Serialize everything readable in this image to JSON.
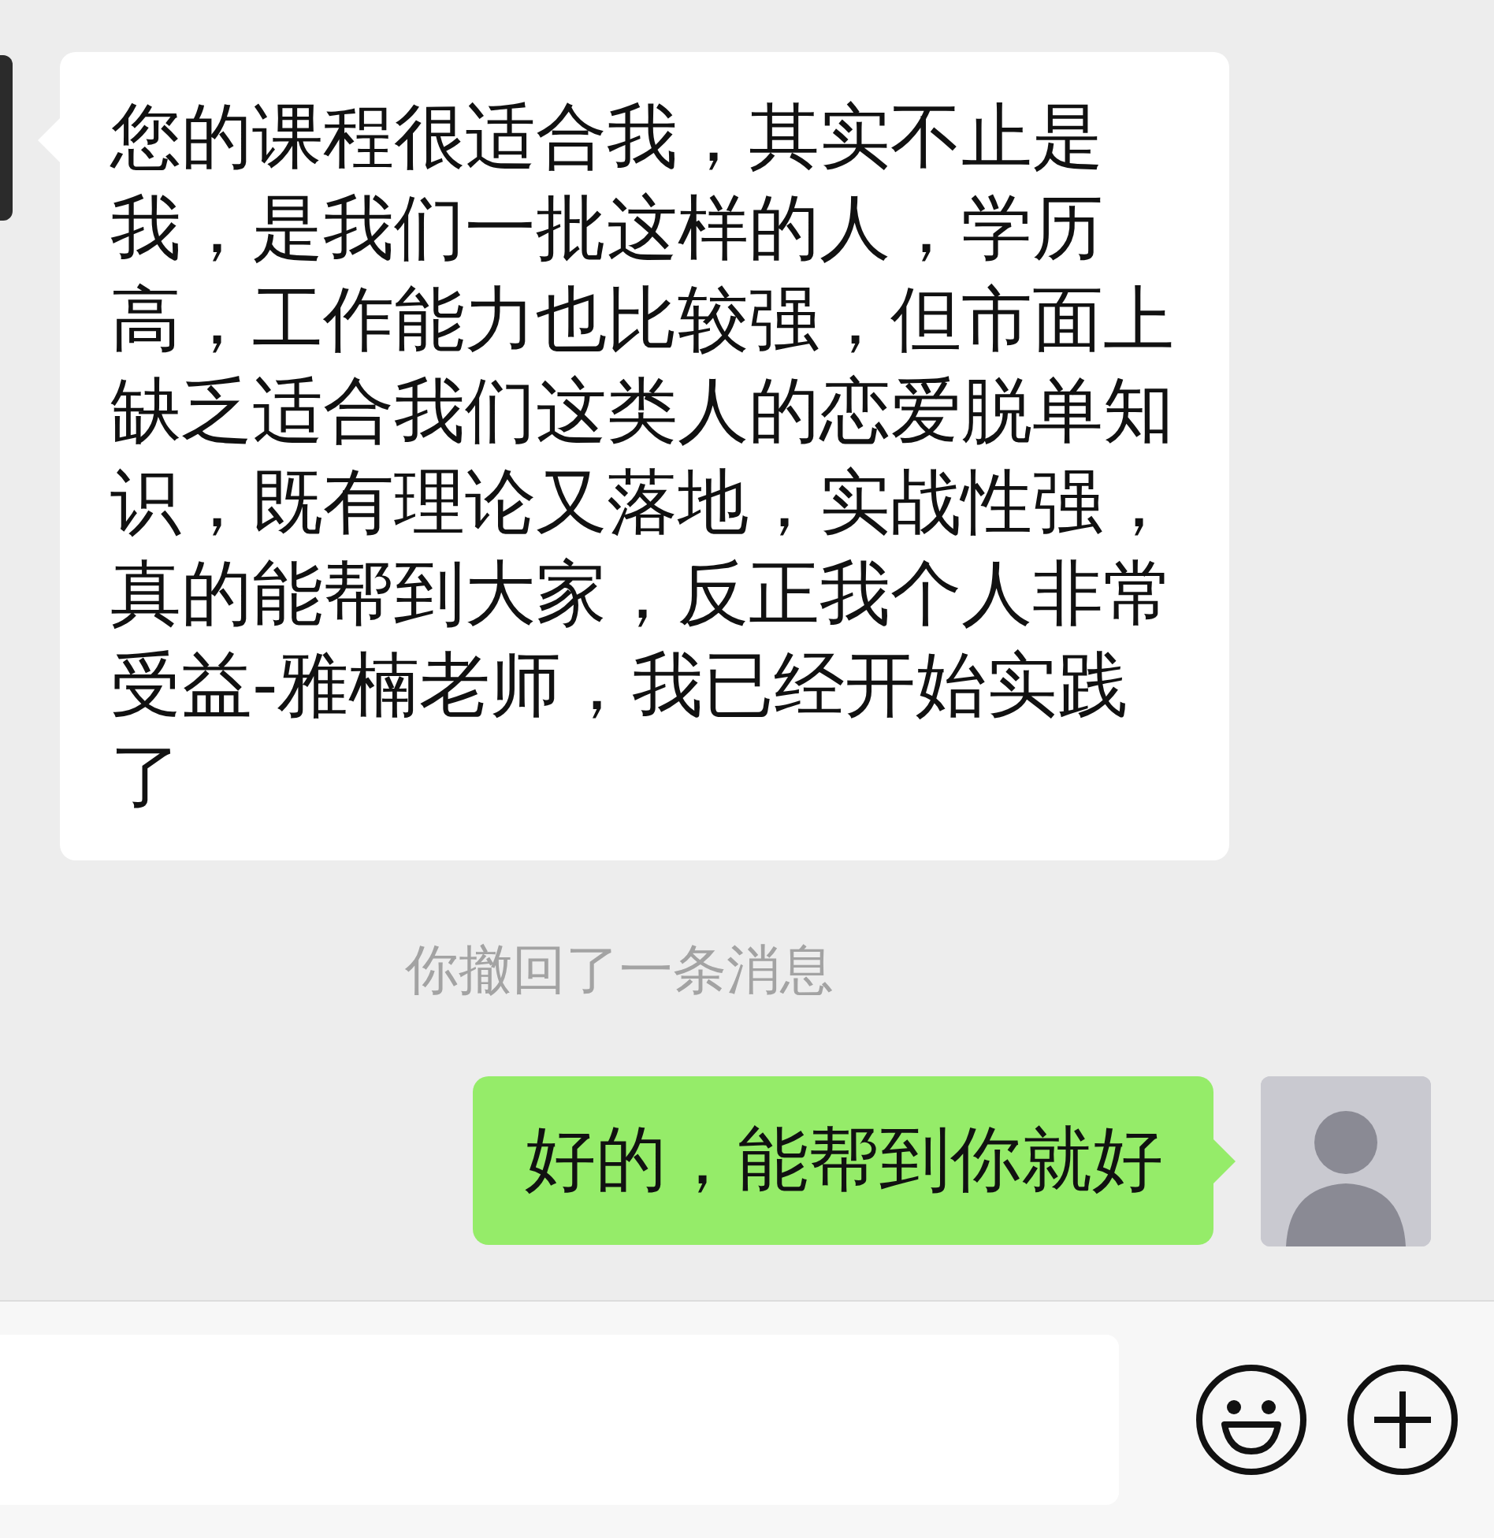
{
  "messages": [
    {
      "kind": "incoming",
      "text": "您的课程很适合我，其实不止是我，是我们一批这样的人，学历高，工作能力也比较强，但市面上缺乏适合我们这类人的恋爱脱单知识，既有理论又落地，实战性强，真的能帮到大家，反正我个人非常受益-雅楠老师，我已经开始实践了"
    },
    {
      "kind": "system",
      "text": "你撤回了一条消息"
    },
    {
      "kind": "outgoing",
      "text": "好的，能帮到你就好"
    }
  ]
}
